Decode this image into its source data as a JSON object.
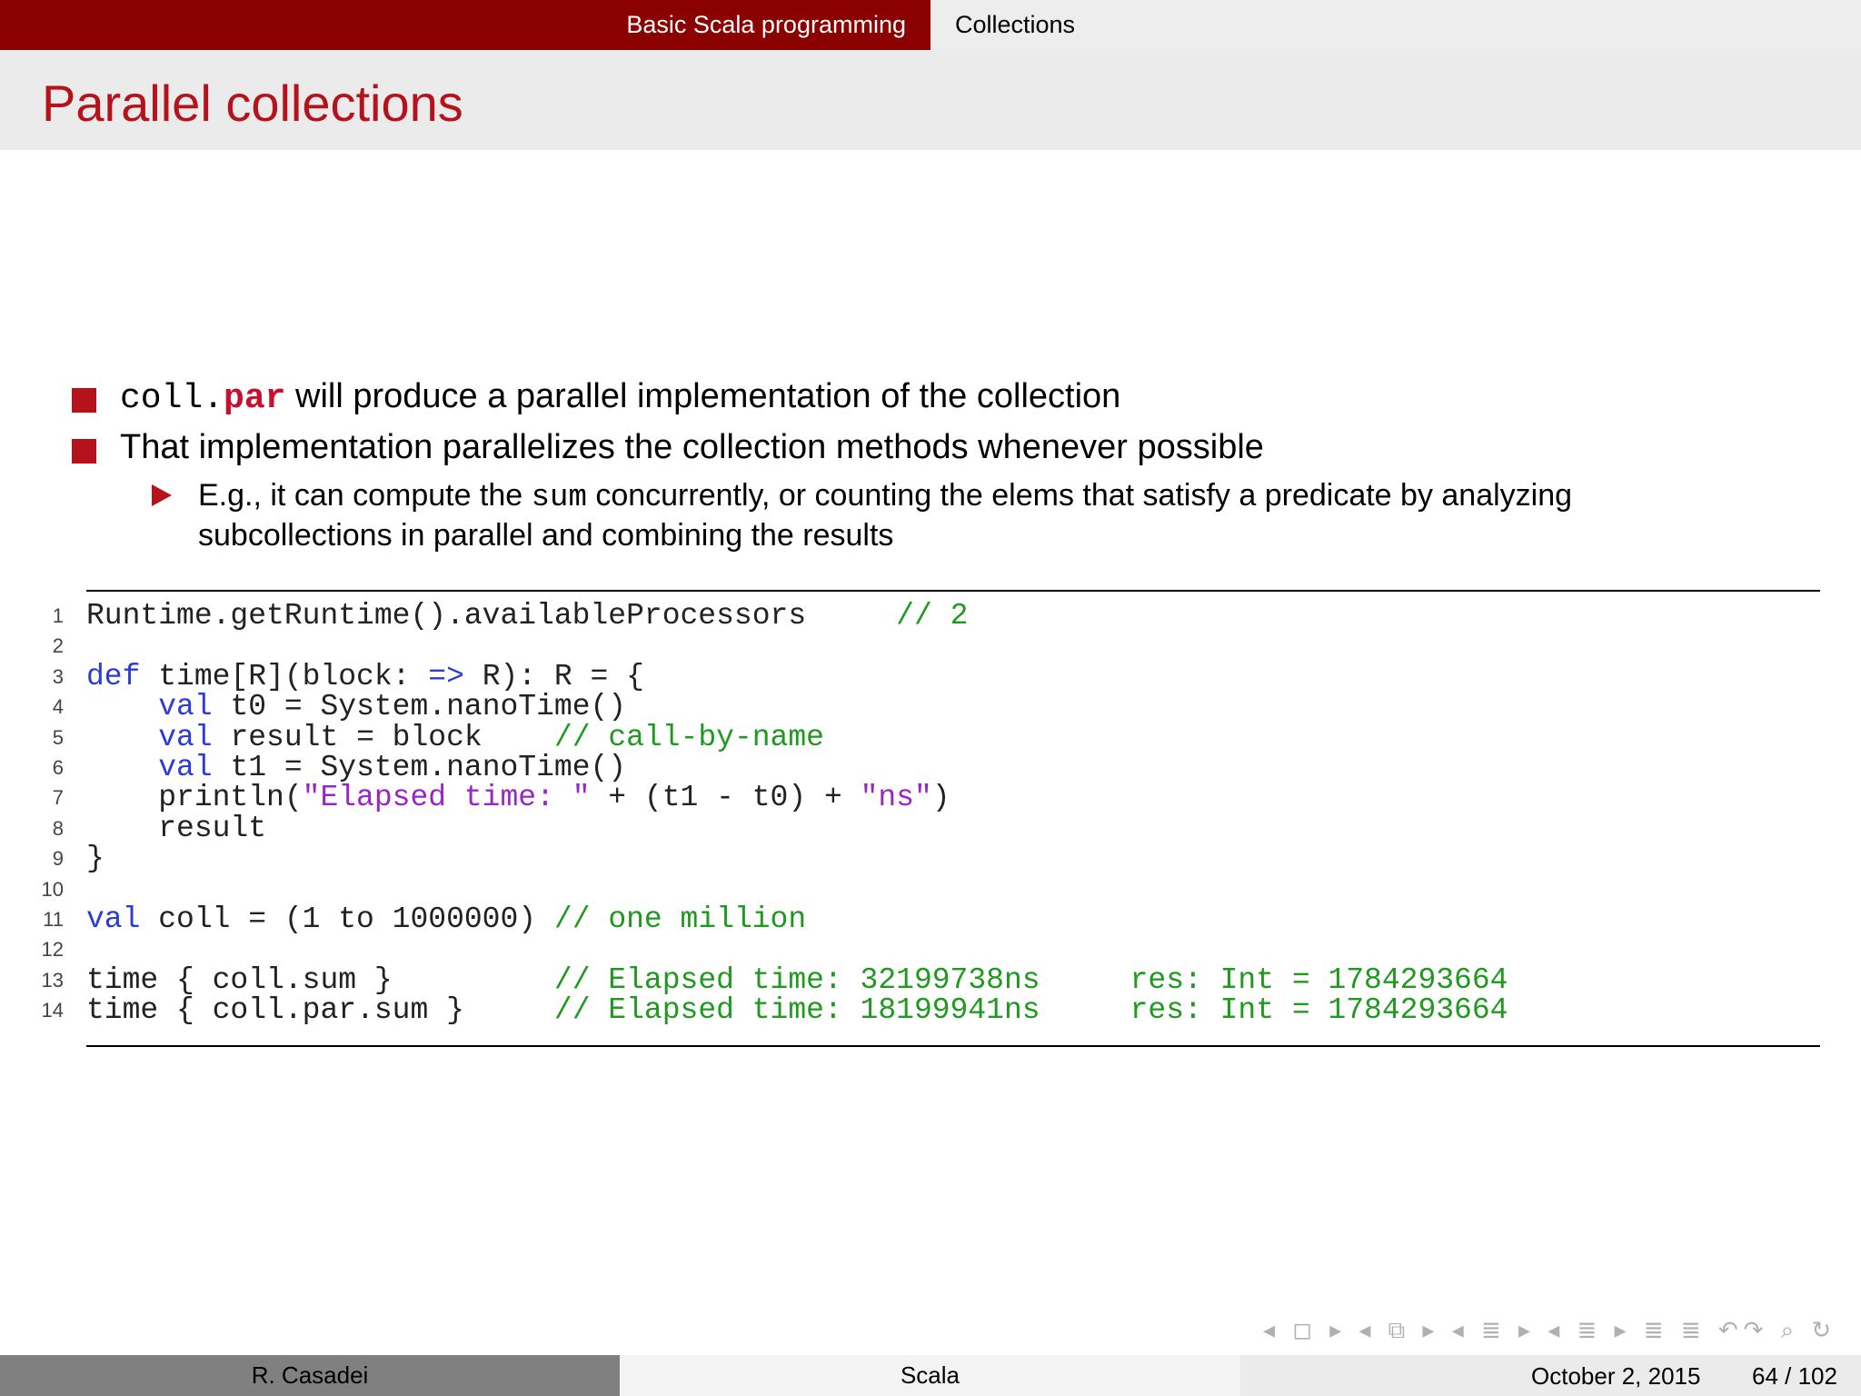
{
  "header": {
    "section": "Basic Scala programming",
    "subsection": "Collections"
  },
  "frame_title": "Parallel collections",
  "bullets": {
    "b1_code_a": "coll.",
    "b1_code_b": "par",
    "b1_text": " will produce a parallel implementation of the collection",
    "b2_text": "That implementation parallelizes the collection methods whenever possible",
    "sub_text_a": "E.g., it can compute the ",
    "sub_code": "sum",
    "sub_text_b": " concurrently, or counting the elems that satisfy a predicate by analyzing subcollections in parallel and combining the results"
  },
  "code": {
    "lines": [
      {
        "n": "1",
        "segs": [
          [
            "",
            "Runtime.getRuntime().availableProcessors     "
          ],
          [
            "cm",
            "// 2"
          ]
        ]
      },
      {
        "n": "2",
        "segs": []
      },
      {
        "n": "3",
        "segs": [
          [
            "kw",
            "def"
          ],
          [
            "",
            " time[R](block: "
          ],
          [
            "kw",
            "=>"
          ],
          [
            "",
            " R): R = {"
          ]
        ]
      },
      {
        "n": "4",
        "segs": [
          [
            "",
            "    "
          ],
          [
            "kw",
            "val"
          ],
          [
            "",
            " t0 = System.nanoTime()"
          ]
        ]
      },
      {
        "n": "5",
        "segs": [
          [
            "",
            "    "
          ],
          [
            "kw",
            "val"
          ],
          [
            "",
            " result = block    "
          ],
          [
            "cm",
            "// call-by-name"
          ]
        ]
      },
      {
        "n": "6",
        "segs": [
          [
            "",
            "    "
          ],
          [
            "kw",
            "val"
          ],
          [
            "",
            " t1 = System.nanoTime()"
          ]
        ]
      },
      {
        "n": "7",
        "segs": [
          [
            "",
            "    println("
          ],
          [
            "str",
            "\"Elapsed time: \""
          ],
          [
            "",
            " + (t1 - t0) + "
          ],
          [
            "str",
            "\"ns\""
          ],
          [
            "",
            ")"
          ]
        ]
      },
      {
        "n": "8",
        "segs": [
          [
            "",
            "    result"
          ]
        ]
      },
      {
        "n": "9",
        "segs": [
          [
            "",
            "}"
          ]
        ]
      },
      {
        "n": "10",
        "segs": []
      },
      {
        "n": "11",
        "segs": [
          [
            "kw",
            "val"
          ],
          [
            "",
            " coll = (1 to 1000000) "
          ],
          [
            "cm",
            "// one million"
          ]
        ]
      },
      {
        "n": "12",
        "segs": []
      },
      {
        "n": "13",
        "segs": [
          [
            "",
            "time { coll.sum }         "
          ],
          [
            "cm",
            "// Elapsed time: 32199738ns     res: Int = 1784293664"
          ]
        ]
      },
      {
        "n": "14",
        "segs": [
          [
            "",
            "time { coll.par.sum }     "
          ],
          [
            "cm",
            "// Elapsed time: 18199941ns     res: Int = 1784293664"
          ]
        ]
      }
    ]
  },
  "nav_symbols": "◂ ◻ ▸  ◂ ⧉ ▸  ◂ ≣ ▸  ◂ ≣ ▸  ≣ ≣  ↶↷ ⌕ ↻",
  "footer": {
    "author": "R. Casadei",
    "title": "Scala",
    "date": "October 2, 2015",
    "page": "64 / 102"
  },
  "colors": {
    "accent": "#8b0000",
    "title": "#b5121b",
    "keyword": "#2a3bd8",
    "comment": "#1f9a1f",
    "string": "#9a25c5"
  }
}
